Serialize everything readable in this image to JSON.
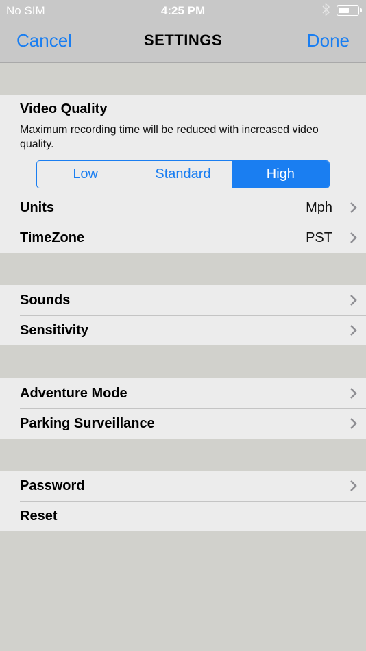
{
  "status": {
    "carrier": "No SIM",
    "time": "4:25 PM"
  },
  "nav": {
    "cancel": "Cancel",
    "title": "SETTINGS",
    "done": "Done"
  },
  "video_quality": {
    "title": "Video Quality",
    "description": "Maximum recording time will be reduced with increased video quality.",
    "options": [
      "Low",
      "Standard",
      "High"
    ],
    "selected": "High"
  },
  "rows": {
    "units": {
      "label": "Units",
      "value": "Mph"
    },
    "timezone": {
      "label": "TimeZone",
      "value": "PST"
    },
    "sounds": {
      "label": "Sounds"
    },
    "sensitivity": {
      "label": "Sensitivity"
    },
    "adventure": {
      "label": "Adventure Mode"
    },
    "parking": {
      "label": "Parking Surveillance"
    },
    "password": {
      "label": "Password"
    },
    "reset": {
      "label": "Reset"
    }
  },
  "colors": {
    "accent": "#1a7ef1",
    "background": "#d1d1cc",
    "cell": "#ececec"
  }
}
